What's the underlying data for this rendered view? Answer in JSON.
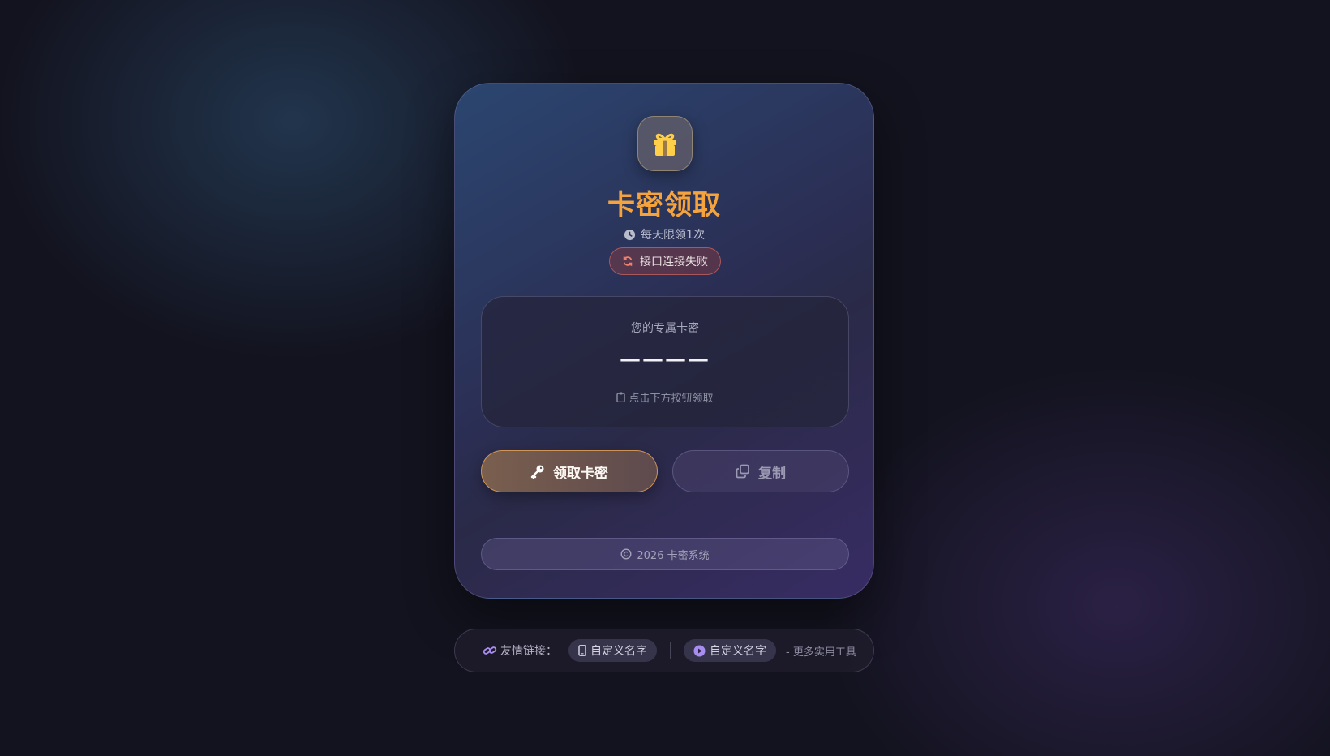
{
  "card": {
    "title": "卡密领取",
    "limit_text": "每天限领1次",
    "status_text": "接口连接失败",
    "code_label": "您的专属卡密",
    "code_value": "————",
    "code_hint": "点击下方按钮领取",
    "claim_label": "领取卡密",
    "copy_label": "复制",
    "footer_text": "2026 卡密系统"
  },
  "links": {
    "label": "友情链接：",
    "items": [
      {
        "label": "自定义名字",
        "icon": "phone-icon"
      },
      {
        "label": "自定义名字",
        "icon": "play-icon"
      }
    ],
    "more": "- 更多实用工具"
  },
  "colors": {
    "accent": "#f5a33a",
    "status_border": "#e66e64",
    "link_icon": "#a98cf0"
  },
  "icons": {
    "header": "gift-icon",
    "limit": "clock-icon",
    "status": "refresh-icon",
    "hint": "clipboard-icon",
    "claim": "key-icon",
    "copy": "copy-icon",
    "footer": "copyright-icon",
    "links": "link-icon"
  }
}
